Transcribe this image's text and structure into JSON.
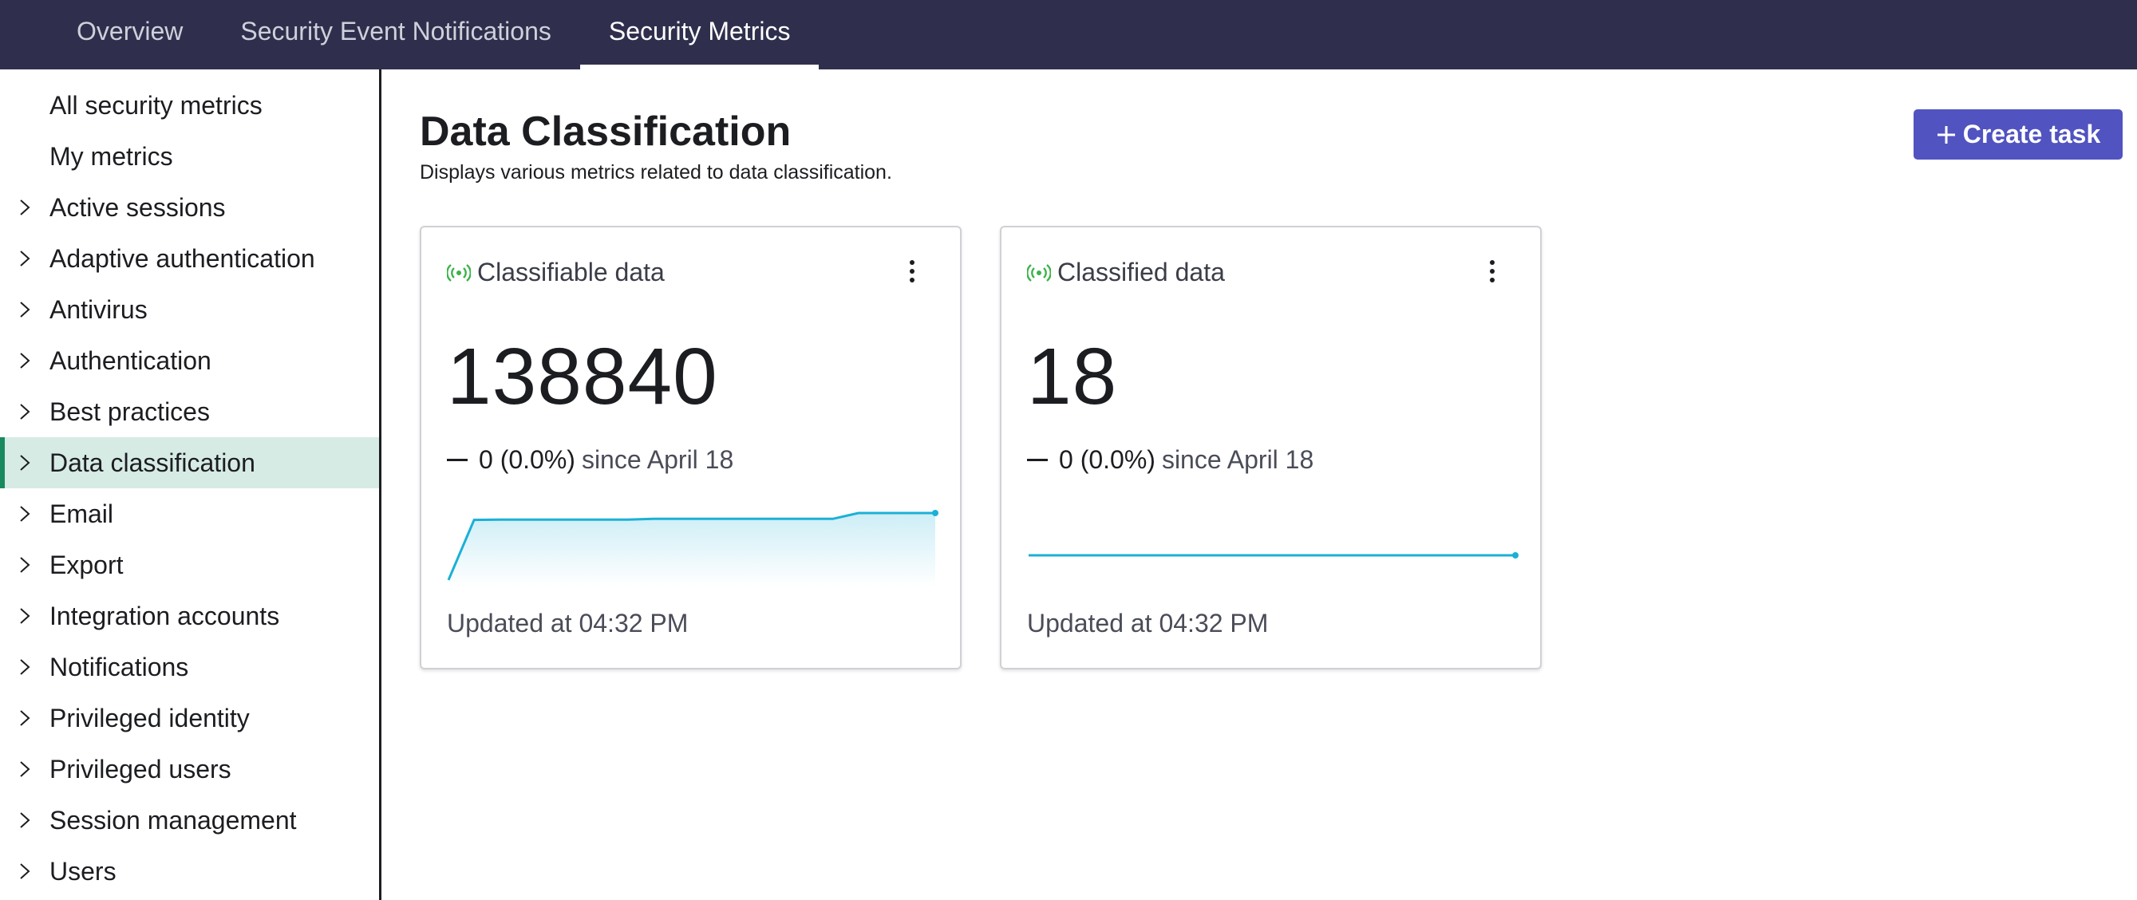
{
  "topnav": {
    "tabs": [
      {
        "label": "Overview",
        "active": false
      },
      {
        "label": "Security Event Notifications",
        "active": false
      },
      {
        "label": "Security Metrics",
        "active": true
      }
    ]
  },
  "sidebar": {
    "items": [
      {
        "label": "All security metrics",
        "expandable": false,
        "selected": false
      },
      {
        "label": "My metrics",
        "expandable": false,
        "selected": false
      },
      {
        "label": "Active sessions",
        "expandable": true,
        "selected": false
      },
      {
        "label": "Adaptive authentication",
        "expandable": true,
        "selected": false
      },
      {
        "label": "Antivirus",
        "expandable": true,
        "selected": false
      },
      {
        "label": "Authentication",
        "expandable": true,
        "selected": false
      },
      {
        "label": "Best practices",
        "expandable": true,
        "selected": false
      },
      {
        "label": "Data classification",
        "expandable": true,
        "selected": true
      },
      {
        "label": "Email",
        "expandable": true,
        "selected": false
      },
      {
        "label": "Export",
        "expandable": true,
        "selected": false
      },
      {
        "label": "Integration accounts",
        "expandable": true,
        "selected": false
      },
      {
        "label": "Notifications",
        "expandable": true,
        "selected": false
      },
      {
        "label": "Privileged identity",
        "expandable": true,
        "selected": false
      },
      {
        "label": "Privileged users",
        "expandable": true,
        "selected": false
      },
      {
        "label": "Session management",
        "expandable": true,
        "selected": false
      },
      {
        "label": "Users",
        "expandable": true,
        "selected": false
      }
    ]
  },
  "main": {
    "title": "Data Classification",
    "subtitle": "Displays various metrics related to data classification.",
    "create_button": "Create task",
    "cards": [
      {
        "title": "Classifiable data",
        "value": "138840",
        "delta": "0 (0.0%)",
        "since": "since April 18",
        "updated": "Updated at 04:32 PM",
        "sparkline": [
          120000,
          136900,
          137000,
          137000,
          137000,
          137000,
          137000,
          137000,
          137200,
          137200,
          137200,
          137200,
          137200,
          137200,
          137200,
          137200,
          138840,
          138840,
          138840,
          138840
        ]
      },
      {
        "title": "Classified data",
        "value": "18",
        "delta": "0 (0.0%)",
        "since": "since April 18",
        "updated": "Updated at 04:32 PM",
        "sparkline": [
          18,
          18,
          18,
          18,
          18,
          18,
          18,
          18,
          18,
          18
        ]
      }
    ]
  },
  "colors": {
    "topnav_bg": "#2f2f4d",
    "accent": "#5153c0",
    "selected_bg": "#d7ebe5",
    "selected_marker": "#198a5e",
    "live_icon": "#3db24a",
    "sparkline": "#1bb0d6"
  },
  "icons": {
    "chevron": "chevron-right-icon",
    "live": "live-signal-icon",
    "menu": "overflow-menu-icon",
    "plus": "plus-icon"
  }
}
